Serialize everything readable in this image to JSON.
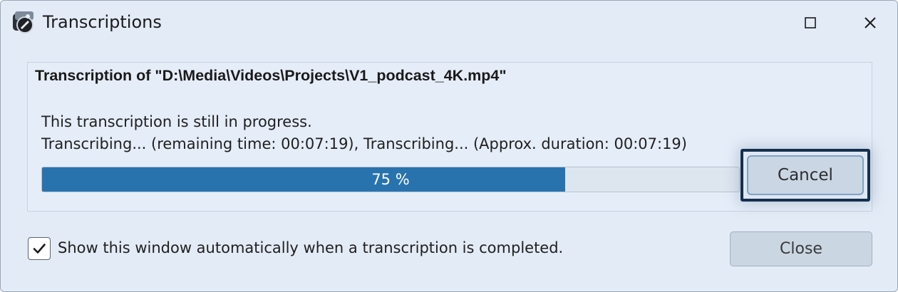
{
  "window": {
    "title": "Transcriptions",
    "icon": "app-icon",
    "controls": {
      "maximize_icon": "maximize-icon",
      "close_icon": "close-icon"
    }
  },
  "transcription": {
    "heading": "Transcription of \"D:\\Media\\Videos\\Projects\\V1_podcast_4K.mp4\"",
    "status_line_1": "This transcription is still in progress.",
    "status_line_2": "Transcribing... (remaining time: 00:07:19), Transcribing... (Approx. duration: 00:07:19)",
    "progress_percent": 75,
    "progress_label": "75 %",
    "cancel_label": "Cancel"
  },
  "footer": {
    "checkbox_checked": true,
    "checkbox_label": "Show this window automatically when a transcription is completed.",
    "close_label": "Close"
  },
  "colors": {
    "window_bg": "#e3ebf6",
    "progress_fill": "#2873ae",
    "focus_border": "#14304f"
  }
}
